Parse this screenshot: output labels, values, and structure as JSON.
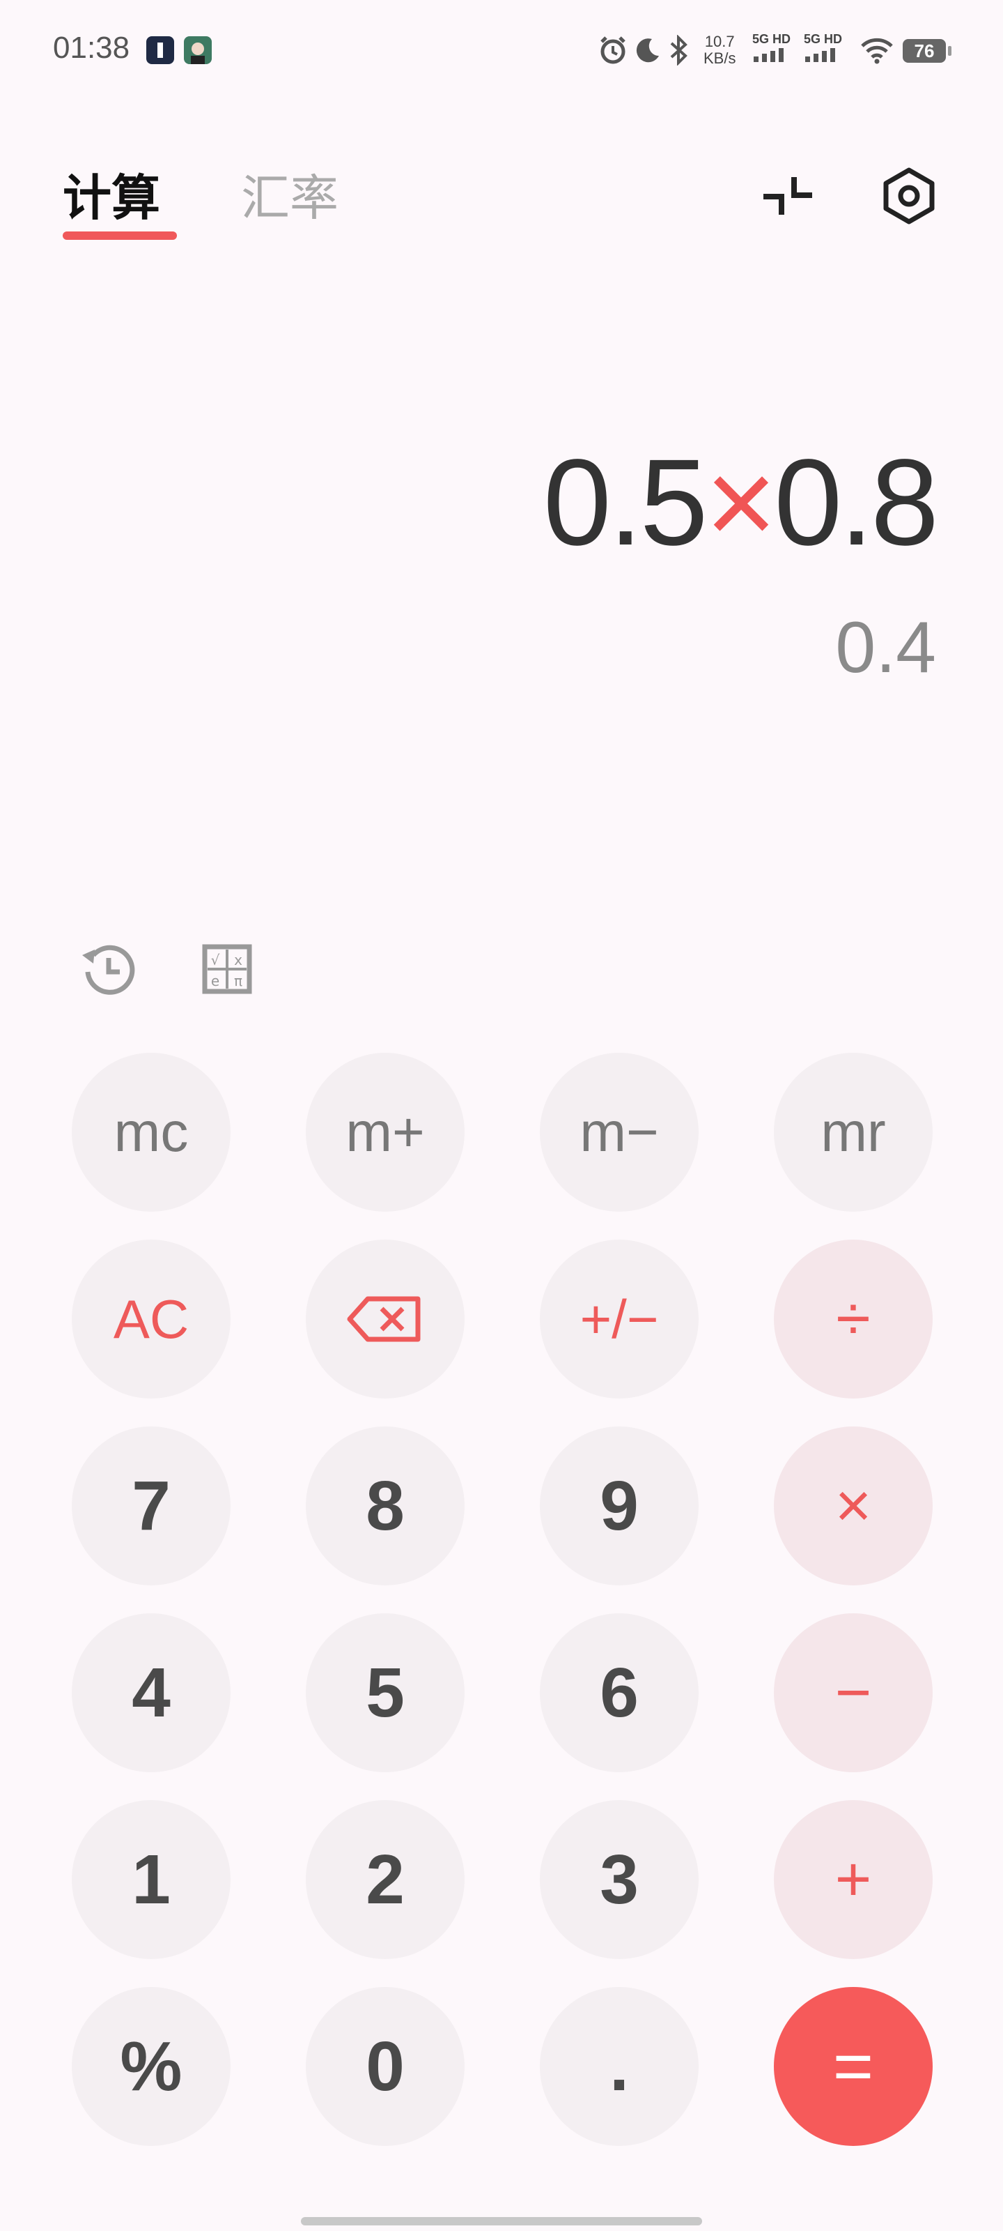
{
  "status_bar": {
    "time": "01:38",
    "net_speed_value": "10.7",
    "net_speed_unit": "KB/s",
    "signal1_label": "5G HD",
    "signal2_label": "5G HD",
    "battery": "76"
  },
  "tabs": {
    "calculate": "计算",
    "exchange_rate": "汇率"
  },
  "display": {
    "operand1": "0.5",
    "operator": "×",
    "operand2": "0.8",
    "result": "0.4"
  },
  "keys": {
    "mc": "mc",
    "m_plus": "m+",
    "m_minus": "m−",
    "mr": "mr",
    "ac": "AC",
    "sign": "+/−",
    "divide": "÷",
    "seven": "7",
    "eight": "8",
    "nine": "9",
    "multiply": "×",
    "four": "4",
    "five": "5",
    "six": "6",
    "minus": "−",
    "one": "1",
    "two": "2",
    "three": "3",
    "plus": "+",
    "percent": "%",
    "zero": "0",
    "dot": ".",
    "equals": "="
  },
  "colors": {
    "accent": "#f05555",
    "background": "#fdf8fb",
    "key_bg": "#f4eff2",
    "op_key_bg": "#f5e6ea",
    "equals_bg": "#f65a5a"
  },
  "icons": {
    "collapse": "collapse-icon",
    "settings": "settings-icon",
    "history": "history-icon",
    "scientific": "scientific-icon",
    "backspace": "backspace-icon"
  }
}
